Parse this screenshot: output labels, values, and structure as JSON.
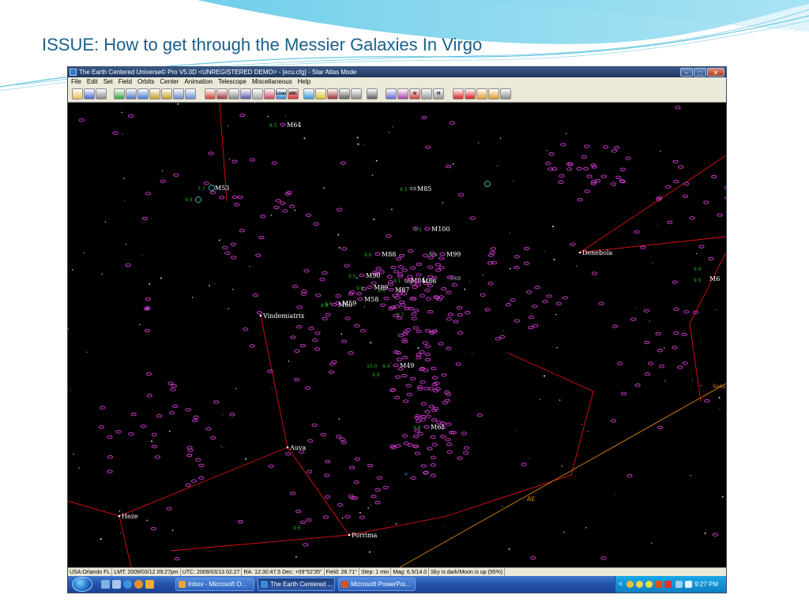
{
  "slide": {
    "title": "ISSUE: How to get through the Messier Galaxies In Virgo"
  },
  "window": {
    "title": "The Earth Centered Universe© Pro V5.0D <UNREGISTERED DEMO> - [ecu.cfg] - Star Atlas Mode",
    "minimize_glyph": "–",
    "maximize_glyph": "□",
    "close_glyph": "✕"
  },
  "menu": [
    "File",
    "Edit",
    "Set",
    "Field",
    "Orbits",
    "Center",
    "Animation",
    "Telescope",
    "Miscellaneous",
    "Help"
  ],
  "colors": {
    "sky": "#000000",
    "galaxy": "#d43bd4",
    "constellation_line": "#e01010",
    "ecliptic": "#d7860c",
    "magnitude_label": "#23b023",
    "object_label": "#ffffff",
    "cluster": "#3ee0e0"
  },
  "toolbar_icons": [
    "open-icon",
    "save-icon",
    "print-icon",
    "undo-icon",
    "zoom-out-icon",
    "zoom-in-icon",
    "north-icon",
    "south-icon",
    "west-east-icon",
    "east-west-icon",
    "cursor-icon",
    "rotate-icon",
    "image-icon",
    "star-icon",
    "grid-icon",
    "labels-icon",
    "lines-icon",
    "text-icon",
    "globe-icon",
    "eclipse-icon",
    "telescope-icon",
    "grid-dots-icon",
    "search-icon",
    "monitor-icon",
    "target-icon",
    "target-icon-2",
    "north-arrow-icon",
    "table-icon",
    "vi-icon",
    "up-icon",
    "down-icon",
    "person-icon",
    "person-icon-2",
    "page-icon"
  ],
  "toolbar_labels": {
    "lines": "Lines",
    "text": "ABC abc",
    "vi": "VI",
    "north": "N"
  },
  "skymap": {
    "objects": [
      {
        "name": "M64",
        "mag": "8.5"
      },
      {
        "name": "M53",
        "mag": "7.7"
      },
      {
        "name": "M85",
        "mag": "9.3"
      },
      {
        "name": "M100",
        "mag": "9.3"
      },
      {
        "name": "M88",
        "mag": "9.6"
      },
      {
        "name": "M99",
        "mag": "9.9"
      },
      {
        "name": "M90",
        "mag": "9.5"
      },
      {
        "name": "M84",
        "mag": "9.1"
      },
      {
        "name": "M86",
        "mag": "8.9"
      },
      {
        "name": "M89",
        "mag": "9.8"
      },
      {
        "name": "M87",
        "mag": "8.6"
      },
      {
        "name": "M58",
        "mag": ""
      },
      {
        "name": "M59",
        "mag": "9.6"
      },
      {
        "name": "M60",
        "mag": "8.8"
      },
      {
        "name": "M49",
        "mag": "8.4"
      },
      {
        "name": "M61",
        "mag": "9.6"
      }
    ],
    "stars": [
      "Denebola",
      "Vindemiatrix",
      "Auva",
      "Heze",
      "Porrima"
    ],
    "ecliptic_label": "AE",
    "edge_labels": {
      "right_object": "M6",
      "saturn": "Satu"
    },
    "extra_mags": [
      "9.9",
      "10.0",
      "9.7",
      "10.0",
      "9.9",
      "9.6",
      "9.9",
      "9.5",
      "9.6"
    ]
  },
  "statusbar": [
    "USA:Orlando FL",
    "LMT: 2009/03/12 09:27pm",
    "UTC: 2009/03/13 02:27",
    "RA: 12:30:47.5 Dec: +09°52'35\"",
    "Field: 26.71°",
    "Step: 1 min",
    "Mag: 6.5/14.0",
    "Sky is dark/Moon is up (95%)"
  ],
  "taskbar": {
    "buttons": [
      {
        "label": "Inbox - Microsoft O...",
        "active": false
      },
      {
        "label": "The Earth Centered ...",
        "active": true
      },
      {
        "label": "Microsoft PowerPoi...",
        "active": false
      }
    ],
    "clock": "9:27 PM",
    "tray_chevron": "<"
  }
}
